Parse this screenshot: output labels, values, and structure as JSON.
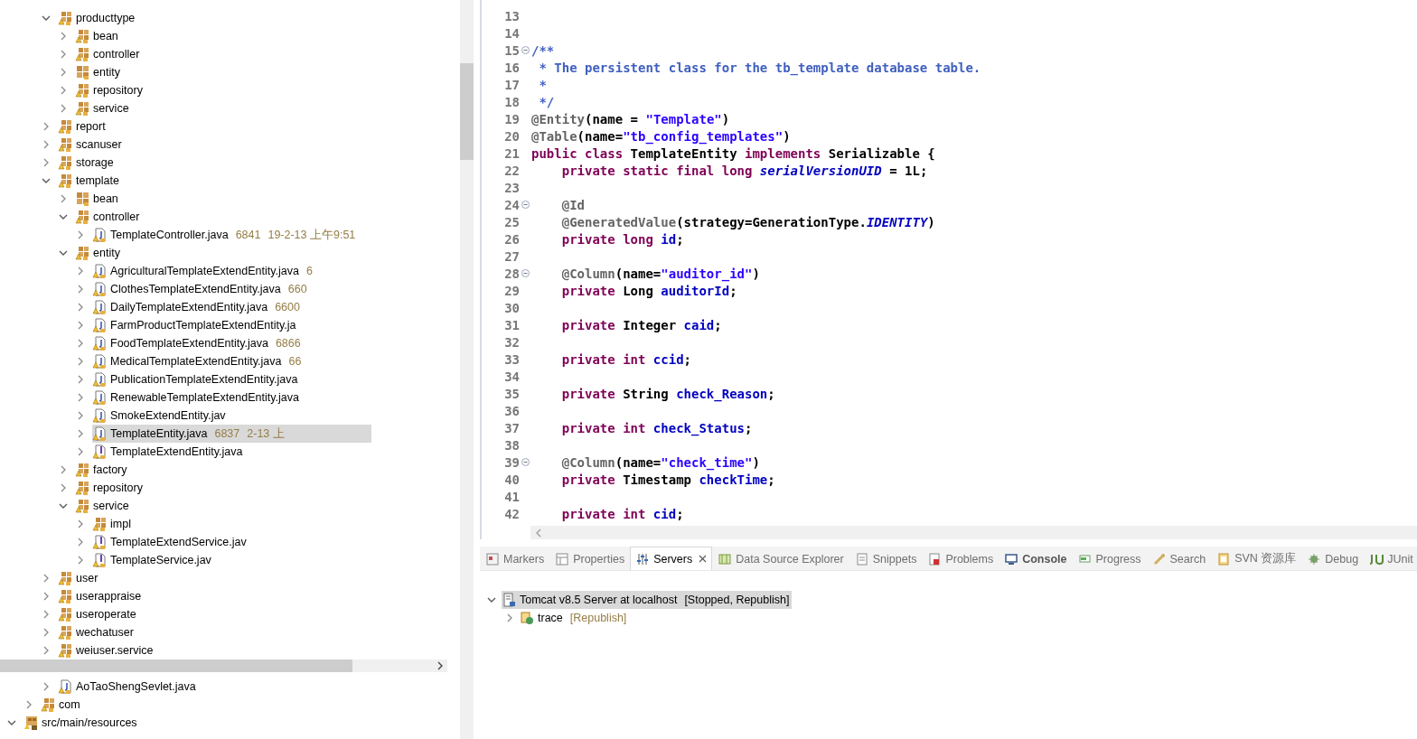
{
  "project_tree": {
    "nodes": [
      {
        "children": [
          {
            "children": [
              {
                "label": "producttype",
                "kind": "package",
                "expanded": true,
                "selected": false,
                "children": [
                  {
                    "label": "bean",
                    "kind": "package",
                    "expanded": false,
                    "selected": false
                  },
                  {
                    "label": "controller",
                    "kind": "package",
                    "expanded": false,
                    "selected": false
                  },
                  {
                    "label": "entity",
                    "kind": "package_plain",
                    "expanded": false,
                    "selected": false
                  },
                  {
                    "label": "repository",
                    "kind": "package",
                    "expanded": false,
                    "selected": false
                  },
                  {
                    "label": "service",
                    "kind": "package",
                    "expanded": false,
                    "selected": false
                  }
                ]
              },
              {
                "label": "report",
                "kind": "package",
                "expanded": false,
                "selected": false
              },
              {
                "label": "scanuser",
                "kind": "package",
                "expanded": false,
                "selected": false
              },
              {
                "label": "storage",
                "kind": "package",
                "expanded": false,
                "selected": false
              },
              {
                "label": "template",
                "kind": "package",
                "expanded": true,
                "selected": false,
                "children": [
                  {
                    "label": "bean",
                    "kind": "package_plain",
                    "expanded": false,
                    "selected": false
                  },
                  {
                    "label": "controller",
                    "kind": "package",
                    "expanded": true,
                    "selected": false,
                    "children": [
                      {
                        "label": "TemplateController.java",
                        "kind": "java",
                        "expanded": false,
                        "selected": false,
                        "decorations": [
                          "6841",
                          "19-2-13 上午9:51"
                        ]
                      }
                    ]
                  },
                  {
                    "label": "entity",
                    "kind": "package",
                    "expanded": true,
                    "selected": false,
                    "children": [
                      {
                        "label": "AgriculturalTemplateExtendEntity.java",
                        "kind": "java",
                        "expanded": false,
                        "selected": false,
                        "decorations": [
                          "6"
                        ]
                      },
                      {
                        "label": "ClothesTemplateExtendEntity.java",
                        "kind": "java",
                        "expanded": false,
                        "selected": false,
                        "decorations": [
                          "660"
                        ]
                      },
                      {
                        "label": "DailyTemplateExtendEntity.java",
                        "kind": "java",
                        "expanded": false,
                        "selected": false,
                        "decorations": [
                          "6600"
                        ]
                      },
                      {
                        "label": "FarmProductTemplateExtendEntity.ja",
                        "kind": "java",
                        "expanded": false,
                        "selected": false
                      },
                      {
                        "label": "FoodTemplateExtendEntity.java",
                        "kind": "java",
                        "expanded": false,
                        "selected": false,
                        "decorations": [
                          "6866"
                        ]
                      },
                      {
                        "label": "MedicalTemplateExtendEntity.java",
                        "kind": "java",
                        "expanded": false,
                        "selected": false,
                        "decorations": [
                          "66"
                        ]
                      },
                      {
                        "label": "PublicationTemplateExtendEntity.java",
                        "kind": "java",
                        "expanded": false,
                        "selected": false
                      },
                      {
                        "label": "RenewableTemplateExtendEntity.java",
                        "kind": "java",
                        "expanded": false,
                        "selected": false
                      },
                      {
                        "label": "SmokeExtendEntity.jav",
                        "kind": "java",
                        "expanded": false,
                        "selected": false
                      },
                      {
                        "label": "TemplateEntity.java",
                        "kind": "java",
                        "expanded": false,
                        "selected": true,
                        "decorations": [
                          "6837",
                          "2-13 上"
                        ]
                      },
                      {
                        "label": "TemplateExtendEntity.java",
                        "kind": "interface",
                        "expanded": false,
                        "selected": false
                      }
                    ]
                  },
                  {
                    "label": "factory",
                    "kind": "package",
                    "expanded": false,
                    "selected": false
                  },
                  {
                    "label": "repository",
                    "kind": "package",
                    "expanded": false,
                    "selected": false
                  },
                  {
                    "label": "service",
                    "kind": "package",
                    "expanded": true,
                    "selected": false,
                    "children": [
                      {
                        "label": "impl",
                        "kind": "package",
                        "expanded": false,
                        "selected": false
                      },
                      {
                        "label": "TemplateExtendService.jav",
                        "kind": "interface",
                        "expanded": false,
                        "selected": false
                      },
                      {
                        "label": "TemplateService.jav",
                        "kind": "interface",
                        "expanded": false,
                        "selected": false
                      }
                    ]
                  }
                ]
              },
              {
                "label": "user",
                "kind": "package",
                "expanded": false,
                "selected": false
              },
              {
                "label": "userappraise",
                "kind": "package",
                "expanded": false,
                "selected": false
              },
              {
                "label": "useroperate",
                "kind": "package",
                "expanded": false,
                "selected": false
              },
              {
                "label": "wechatuser",
                "kind": "package",
                "expanded": false,
                "selected": false
              },
              {
                "label": "weiuser.service",
                "kind": "package",
                "expanded": false,
                "selected": false
              }
            ]
          }
        ]
      }
    ]
  },
  "project_tree_lower": {
    "nodes": [
      {
        "children": [
          {
            "children": [
              {
                "label": "AoTaoShengSevlet.java",
                "kind": "java",
                "expanded": false,
                "selected": false
              }
            ]
          },
          {
            "label": "com",
            "kind": "package",
            "expanded": false,
            "selected": false
          }
        ]
      },
      {
        "label": "src/main/resources",
        "kind": "source_folder",
        "expanded": true,
        "selected": false
      }
    ]
  },
  "editor": {
    "lines": [
      {
        "number": "13"
      },
      {
        "number": "14"
      },
      {
        "number": "15",
        "fold": true,
        "tokens": [
          {
            "kind": "doc",
            "text": "/**"
          }
        ]
      },
      {
        "number": "16",
        "tokens": [
          {
            "kind": "doc",
            "text": " * The persistent class for the tb_template database table."
          }
        ]
      },
      {
        "number": "17",
        "tokens": [
          {
            "kind": "doc",
            "text": " *"
          }
        ]
      },
      {
        "number": "18",
        "tokens": [
          {
            "kind": "doc",
            "text": " */"
          }
        ]
      },
      {
        "number": "19",
        "tokens": [
          {
            "kind": "ann",
            "text": "@Entity"
          },
          {
            "kind": "plain",
            "text": "(name = "
          },
          {
            "kind": "str",
            "text": "\"Template\""
          },
          {
            "kind": "plain",
            "text": ")"
          }
        ]
      },
      {
        "number": "20",
        "tokens": [
          {
            "kind": "ann",
            "text": "@Table"
          },
          {
            "kind": "plain",
            "text": "(name="
          },
          {
            "kind": "str",
            "text": "\"tb_config_templates\""
          },
          {
            "kind": "plain",
            "text": ")"
          }
        ]
      },
      {
        "number": "21",
        "tokens": [
          {
            "kind": "kw",
            "text": "public class"
          },
          {
            "kind": "plain",
            "text": " TemplateEntity "
          },
          {
            "kind": "kw",
            "text": "implements"
          },
          {
            "kind": "plain",
            "text": " Serializable {"
          }
        ]
      },
      {
        "number": "22",
        "tokens": [
          {
            "kind": "kw",
            "text": "    private static final long"
          },
          {
            "kind": "static",
            "text": " serialVersionUID"
          },
          {
            "kind": "plain",
            "text": " = 1L;"
          }
        ]
      },
      {
        "number": "23"
      },
      {
        "number": "24",
        "fold": true,
        "tokens": [
          {
            "kind": "ann",
            "text": "    @Id"
          }
        ]
      },
      {
        "number": "25",
        "tokens": [
          {
            "kind": "ann",
            "text": "    @GeneratedValue"
          },
          {
            "kind": "plain",
            "text": "(strategy=GenerationType."
          },
          {
            "kind": "static",
            "text": "IDENTITY"
          },
          {
            "kind": "plain",
            "text": ")"
          }
        ]
      },
      {
        "number": "26",
        "tokens": [
          {
            "kind": "kw",
            "text": "    private long"
          },
          {
            "kind": "field",
            "text": " id"
          },
          {
            "kind": "plain",
            "text": ";"
          }
        ]
      },
      {
        "number": "27"
      },
      {
        "number": "28",
        "fold": true,
        "tokens": [
          {
            "kind": "ann",
            "text": "    @Column"
          },
          {
            "kind": "plain",
            "text": "(name="
          },
          {
            "kind": "str",
            "text": "\"auditor_id\""
          },
          {
            "kind": "plain",
            "text": ")"
          }
        ]
      },
      {
        "number": "29",
        "tokens": [
          {
            "kind": "kw",
            "text": "    private"
          },
          {
            "kind": "plain",
            "text": " Long "
          },
          {
            "kind": "field",
            "text": "auditorId"
          },
          {
            "kind": "plain",
            "text": ";"
          }
        ]
      },
      {
        "number": "30"
      },
      {
        "number": "31",
        "tokens": [
          {
            "kind": "kw",
            "text": "    private"
          },
          {
            "kind": "plain",
            "text": " Integer "
          },
          {
            "kind": "field",
            "text": "caid"
          },
          {
            "kind": "plain",
            "text": ";"
          }
        ]
      },
      {
        "number": "32"
      },
      {
        "number": "33",
        "tokens": [
          {
            "kind": "kw",
            "text": "    private int"
          },
          {
            "kind": "field",
            "text": " ccid"
          },
          {
            "kind": "plain",
            "text": ";"
          }
        ]
      },
      {
        "number": "34"
      },
      {
        "number": "35",
        "tokens": [
          {
            "kind": "kw",
            "text": "    private"
          },
          {
            "kind": "plain",
            "text": " String "
          },
          {
            "kind": "field",
            "text": "check_Reason"
          },
          {
            "kind": "plain",
            "text": ";"
          }
        ]
      },
      {
        "number": "36"
      },
      {
        "number": "37",
        "tokens": [
          {
            "kind": "kw",
            "text": "    private int"
          },
          {
            "kind": "field",
            "text": " check_Status"
          },
          {
            "kind": "plain",
            "text": ";"
          }
        ]
      },
      {
        "number": "38"
      },
      {
        "number": "39",
        "fold": true,
        "tokens": [
          {
            "kind": "ann",
            "text": "    @Column"
          },
          {
            "kind": "plain",
            "text": "(name="
          },
          {
            "kind": "str",
            "text": "\"check_time\""
          },
          {
            "kind": "plain",
            "text": ")"
          }
        ]
      },
      {
        "number": "40",
        "tokens": [
          {
            "kind": "kw",
            "text": "    private"
          },
          {
            "kind": "plain",
            "text": " Timestamp "
          },
          {
            "kind": "field",
            "text": "checkTime"
          },
          {
            "kind": "plain",
            "text": ";"
          }
        ]
      },
      {
        "number": "41"
      },
      {
        "number": "42",
        "tokens": [
          {
            "kind": "kw",
            "text": "    private int"
          },
          {
            "kind": "field",
            "text": " cid"
          },
          {
            "kind": "plain",
            "text": ";"
          }
        ]
      }
    ]
  },
  "bottom_panel": {
    "tabs": [
      {
        "label": "Markers",
        "selected": false,
        "bold": false
      },
      {
        "label": "Properties",
        "selected": false,
        "bold": false
      },
      {
        "label": "Servers",
        "selected": true,
        "bold": false
      },
      {
        "label": "Data Source Explorer",
        "selected": false,
        "bold": false
      },
      {
        "label": "Snippets",
        "selected": false,
        "bold": false
      },
      {
        "label": "Problems",
        "selected": false,
        "bold": false
      },
      {
        "label": "Console",
        "selected": false,
        "bold": true
      },
      {
        "label": "Progress",
        "selected": false,
        "bold": false
      },
      {
        "label": "Search",
        "selected": false,
        "bold": false
      },
      {
        "label": "SVN 资源库",
        "selected": false,
        "bold": false
      },
      {
        "label": "Debug",
        "selected": false,
        "bold": false
      },
      {
        "label": "JUnit",
        "selected": false,
        "bold": false
      }
    ],
    "servers": [
      {
        "label": "Tomcat v8.5 Server at localhost",
        "status": "[Stopped, Republish]",
        "kind": "server",
        "expanded": true,
        "selected": true,
        "children": [
          {
            "label": "trace",
            "status": "[Republish]",
            "kind": "module",
            "expanded": false,
            "selected": false
          }
        ]
      }
    ]
  }
}
